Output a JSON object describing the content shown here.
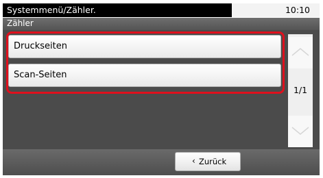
{
  "header": {
    "title": "Systemmenü/Zähler.",
    "clock": "10:10"
  },
  "subheader": {
    "title": "Zähler"
  },
  "menu": {
    "items": [
      {
        "label": "Druckseiten"
      },
      {
        "label": "Scan-Seiten"
      }
    ]
  },
  "pager": {
    "page": "1/1"
  },
  "footer": {
    "back_label": "Zurück"
  },
  "colors": {
    "highlight": "#e0101d",
    "title_bar": "#000000",
    "content_bg": "#4b4b4b"
  },
  "icons": {
    "scroll_up": "chevron-up-icon",
    "scroll_down": "chevron-down-icon",
    "back": "chevron-left-icon"
  }
}
